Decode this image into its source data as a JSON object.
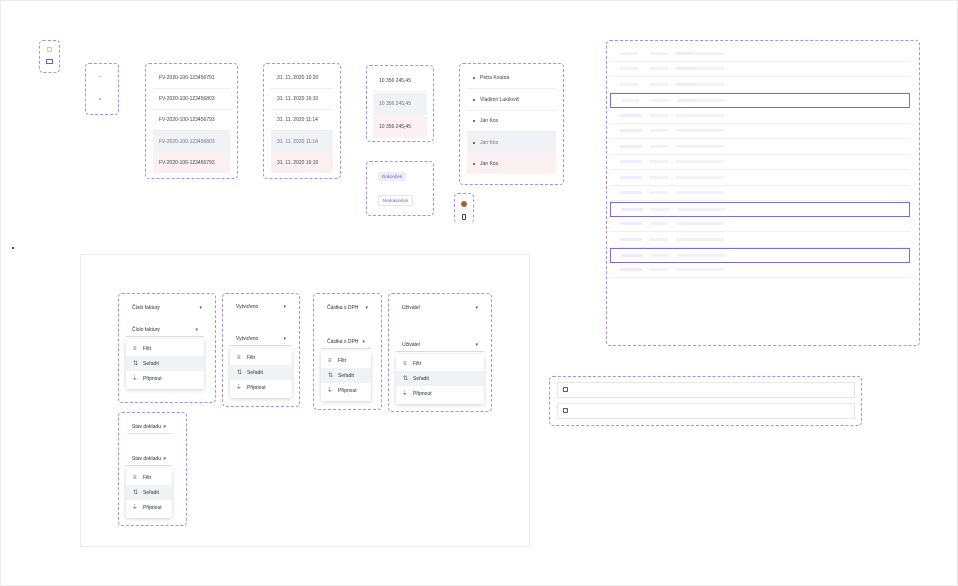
{
  "invoice_numbers": [
    "FV-2020-100-123456791",
    "FV-2020-100-123456803",
    "FV-2020-100-123456793",
    "FV-2020-100-123456803",
    "FV-2020-100-123456793"
  ],
  "dates": [
    "31. 11. 2020 10:20",
    "31. 11. 2020 16:10",
    "31. 11. 2020 11:14",
    "31. 11. 2020 11:14",
    "31. 11. 2020 16:10"
  ],
  "amounts": [
    "10 356 245,45",
    "10 356 245,45",
    "10 356 245,45"
  ],
  "persons": [
    "Petra Koutná",
    "Vladimír Lukšovič",
    "Jan Kos",
    "Jan Kos",
    "Jan Kos"
  ],
  "statuses": [
    "Dokončen",
    "Nedokončen"
  ],
  "headers": {
    "invoice": "Číslo faktury",
    "created": "Vytvořeno",
    "amount": "Částka s DPH",
    "user": "Uživatel",
    "status": "Stav dokladu"
  },
  "menu": {
    "filter": "Filtr",
    "sort": "Seřadit",
    "pin": "Připnout"
  },
  "icons": {
    "filter": "filter-icon",
    "sort": "sort-icon",
    "pin": "pin-icon",
    "chevron": "chevron-down-icon",
    "checkbox": "checkbox-icon",
    "mail": "mail-icon",
    "avatar": "avatar-icon"
  },
  "colors": {
    "accent": "#7b6ae0",
    "dashed": "#a98ef0",
    "hover": "#f1f2f5",
    "selected": "#fdf0f3"
  }
}
